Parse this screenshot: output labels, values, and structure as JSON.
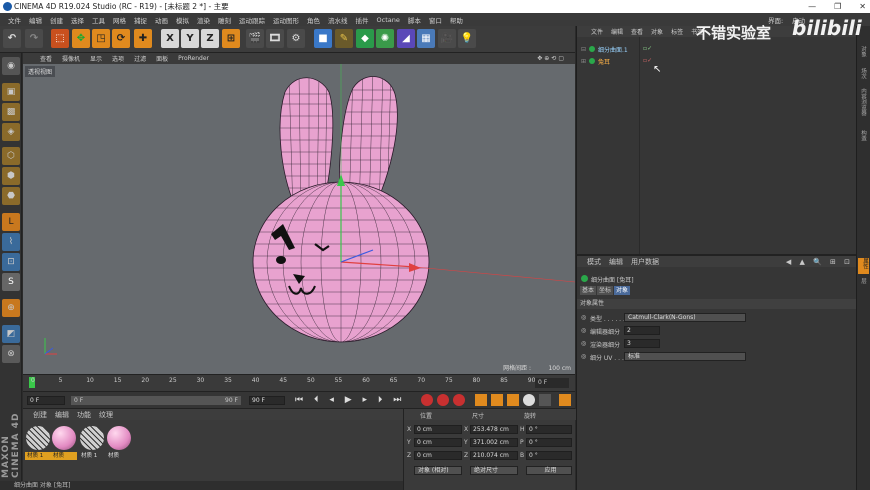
{
  "titlebar": {
    "title": "CINEMA 4D R19.024 Studio (RC - R19) - [未标题 2 *] - 主要",
    "minimize": "—",
    "maximize": "❐",
    "close": "✕"
  },
  "menubar": [
    "文件",
    "编辑",
    "创建",
    "选择",
    "工具",
    "网格",
    "捕捉",
    "动画",
    "模拟",
    "渲染",
    "雕刻",
    "运动跟踪",
    "运动图形",
    "角色",
    "流水线",
    "插件",
    "Octane",
    "脚本",
    "窗口",
    "帮助"
  ],
  "menubar_right": [
    "界面:",
    "启动"
  ],
  "watermark": {
    "text": "不错实验室",
    "brand": "bilibili"
  },
  "toolbar": {
    "axis_x": "X",
    "axis_y": "Y",
    "axis_z": "Z"
  },
  "viewport": {
    "menu": [
      "查看",
      "摄像机",
      "显示",
      "选项",
      "过滤",
      "面板",
      "ProRender"
    ],
    "label": "透视视图",
    "grid_label": "网格间距 :",
    "grid_value": "100 cm"
  },
  "timeline": {
    "ticks": [
      "0",
      "5",
      "10",
      "15",
      "20",
      "25",
      "30",
      "35",
      "40",
      "45",
      "50",
      "55",
      "60",
      "65",
      "70",
      "75",
      "80",
      "85",
      "90"
    ],
    "end_frame": "0 F"
  },
  "transport": {
    "start": "0 F",
    "range_start": "0 F",
    "range_end": "90 F",
    "end": "90 F"
  },
  "materials": {
    "menu": [
      "创建",
      "编辑",
      "功能",
      "纹理"
    ],
    "items": [
      {
        "name": "材质 1",
        "kind": "sketch"
      },
      {
        "name": "材质",
        "kind": "pink"
      },
      {
        "name": "材质 1",
        "kind": "sketch"
      },
      {
        "name": "材质",
        "kind": "pink"
      }
    ]
  },
  "coords": {
    "headers": [
      "位置",
      "尺寸",
      "旋转"
    ],
    "rows": [
      {
        "axis": "X",
        "pos": "0 cm",
        "size": "253.478 cm",
        "rot_label": "H",
        "rot": "0 °"
      },
      {
        "axis": "Y",
        "pos": "0 cm",
        "size": "371.002 cm",
        "rot_label": "P",
        "rot": "0 °"
      },
      {
        "axis": "Z",
        "pos": "0 cm",
        "size": "210.074 cm",
        "rot_label": "B",
        "rot": "0 °"
      }
    ],
    "mode": "对象 (相对)",
    "size_mode": "绝对尺寸",
    "apply": "应用"
  },
  "objects": {
    "menu": [
      "文件",
      "编辑",
      "查看",
      "对象",
      "标签",
      "书签"
    ],
    "items": [
      {
        "name": "细分曲面.1",
        "color": "#9ad4ff"
      },
      {
        "name": "兔耳",
        "color": "#ffb347"
      }
    ]
  },
  "attributes": {
    "menu": [
      "模式",
      "编辑",
      "用户数据"
    ],
    "object_title": "细分曲面 [兔耳]",
    "tabs": [
      "基本",
      "坐标",
      "对象"
    ],
    "section": "对象属性",
    "rows": [
      {
        "label": "类型 . . . . . . .",
        "value": "Catmull-Clark(N-Gons)",
        "type": "dropdown"
      },
      {
        "label": "编辑器细分",
        "value": "2",
        "type": "field"
      },
      {
        "label": "渲染器细分",
        "value": "3",
        "type": "field"
      },
      {
        "label": "细分 UV . . . .",
        "value": "标准",
        "type": "dropdown"
      }
    ]
  },
  "statusbar": "细分曲面 对象 [兔耳]",
  "side_labels": [
    "对象",
    "场次",
    "内容浏览器",
    "构造"
  ],
  "attr_side_labels": [
    "属性",
    "层"
  ],
  "maxon": "MAXON CINEMA 4D"
}
